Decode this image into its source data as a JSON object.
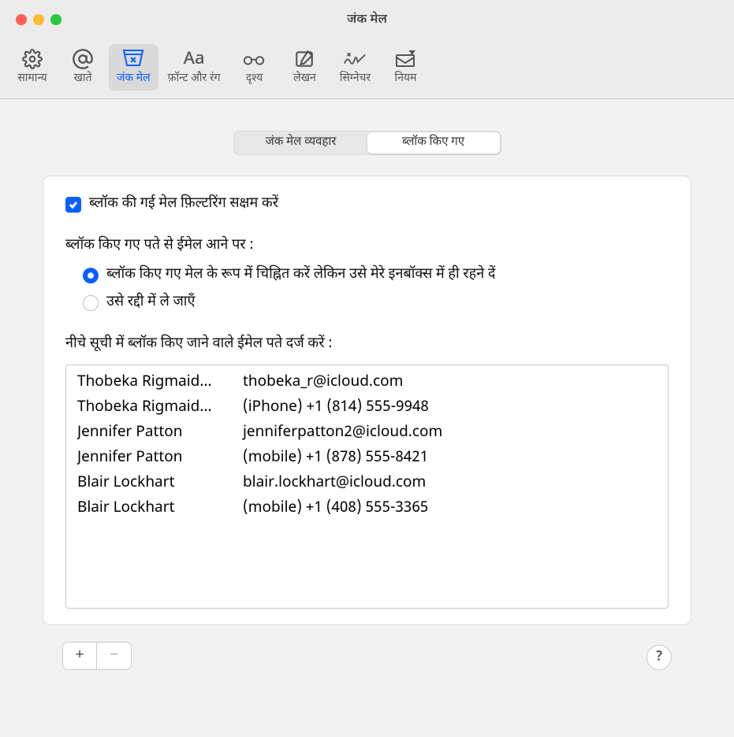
{
  "window": {
    "title": "जंक मेल"
  },
  "toolbar": {
    "items": [
      {
        "id": "general",
        "label": "सामान्य"
      },
      {
        "id": "accounts",
        "label": "खाते"
      },
      {
        "id": "junkmail",
        "label": "जंक मेल",
        "active": true
      },
      {
        "id": "fonts",
        "label": "फ़ॉन्ट और रंग"
      },
      {
        "id": "viewing",
        "label": "दृश्य"
      },
      {
        "id": "composing",
        "label": "लेखन"
      },
      {
        "id": "signatures",
        "label": "सिग्नेचर"
      },
      {
        "id": "rules",
        "label": "नियम"
      }
    ]
  },
  "segmented": {
    "tabs": [
      {
        "label": "जंक मेल व्यवहार",
        "selected": false
      },
      {
        "label": "ब्लॉक किए गए",
        "selected": true
      }
    ]
  },
  "blocked": {
    "enable_label": "ब्लॉक की गई मेल फ़िल्टरिंग सक्षम करें",
    "when_heading": "ब्लॉक किए गए पते से ईमेल आने पर :",
    "options": [
      {
        "label": "ब्लॉक किए गए मेल के रूप में चिह्नित करें लेकिन उसे मेरे इनबॉक्स में ही रहने दें",
        "selected": true
      },
      {
        "label": "उसे रद्दी में ले जाएँ",
        "selected": false
      }
    ],
    "list_heading": "नीचे सूची में ब्लॉक किए जाने वाले ईमेल पते दर्ज करें :",
    "entries": [
      {
        "name": "Thobeka Rigmaid...",
        "value": "thobeka_r@icloud.com"
      },
      {
        "name": "Thobeka Rigmaid...",
        "value": "(iPhone) +1 (814) 555-9948"
      },
      {
        "name": "Jennifer Patton",
        "value": "jenniferpatton2@icloud.com"
      },
      {
        "name": "Jennifer Patton",
        "value": "(mobile) +1 (878) 555-8421"
      },
      {
        "name": "Blair Lockhart",
        "value": "blair.lockhart@icloud.com"
      },
      {
        "name": "Blair Lockhart",
        "value": "(mobile) +1 (408) 555-3365"
      }
    ],
    "add_label": "+",
    "remove_label": "−",
    "help_label": "?"
  },
  "icons": {
    "general": "gear-icon",
    "accounts": "at-icon",
    "junkmail": "junk-box-icon",
    "fonts": "aa-icon",
    "viewing": "glasses-icon",
    "composing": "compose-icon",
    "signatures": "signature-icon",
    "rules": "rules-icon"
  }
}
